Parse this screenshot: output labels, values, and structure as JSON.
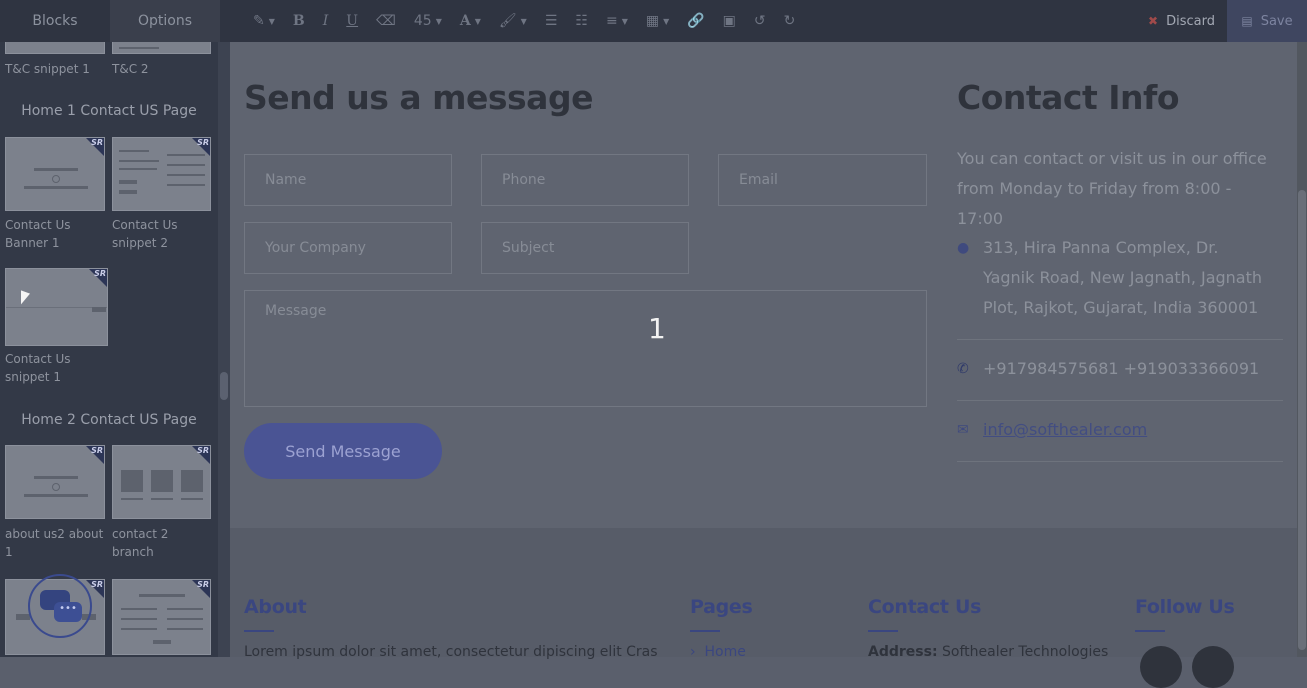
{
  "toolbar": {
    "tabs": [
      "Blocks",
      "Options"
    ],
    "font_size": "45",
    "discard_label": "Discard",
    "save_label": "Save"
  },
  "sidebar": {
    "top_labels": [
      "T&C snippet 1",
      "T&C 2"
    ],
    "section1_title": "Home 1 Contact US Page",
    "section1_items": [
      "Contact Us Banner 1",
      "Contact Us snippet 2",
      "Contact Us snippet 1"
    ],
    "section2_title": "Home 2 Contact US Page",
    "section2_items": [
      "about us2 about 1",
      "contact 2 branch"
    ],
    "thumb_badge": "SR"
  },
  "form": {
    "heading": "Send us a message",
    "placeholders": {
      "name": "Name",
      "phone": "Phone",
      "email": "Email",
      "company": "Your Company",
      "subject": "Subject",
      "message": "Message"
    },
    "button": "Send Message",
    "overlay_number": "1"
  },
  "contact": {
    "heading": "Contact Info",
    "intro": "You can contact or visit us in our office from Monday to Friday from 8:00 - 17:00",
    "address": "313, Hira Panna Complex, Dr. Yagnik Road, New Jagnath, Jagnath Plot, Rajkot, Gujarat, India 360001",
    "phones": "+917984575681   +919033366091",
    "email": "info@softhealer.com"
  },
  "footer": {
    "about_heading": "About",
    "about_text": "Lorem ipsum dolor sit amet, consectetur dipiscing elit Cras",
    "pages_heading": "Pages",
    "pages_first": "Home",
    "contact_heading": "Contact Us",
    "contact_address_label": "Address:",
    "contact_address_value": "Softhealer Technologies",
    "follow_heading": "Follow Us"
  }
}
